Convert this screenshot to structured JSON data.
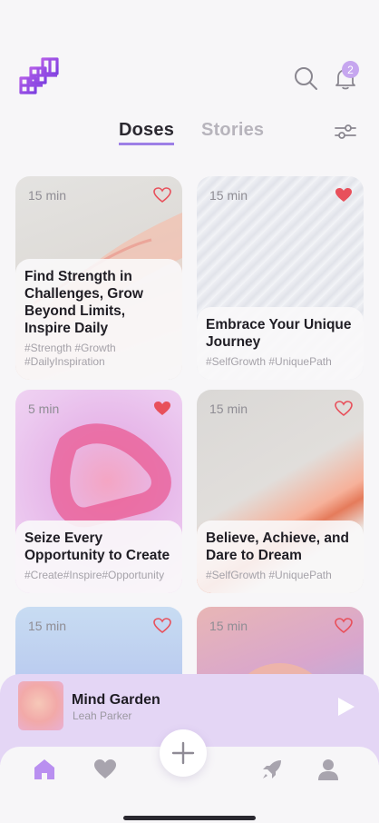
{
  "header": {
    "notification_count": "2"
  },
  "tabs": [
    {
      "label": "Doses",
      "active": true
    },
    {
      "label": "Stories",
      "active": false
    }
  ],
  "cards": [
    {
      "duration": "15 min",
      "liked": false,
      "title": "Find Strength in Challenges, Grow Beyond Limits, Inspire Daily",
      "tags": "#Strength #Growth #DailyInspiration"
    },
    {
      "duration": "15 min",
      "liked": true,
      "title": "Embrace Your Unique Journey",
      "tags": "#SelfGrowth #UniquePath"
    },
    {
      "duration": "5 min",
      "liked": true,
      "title": "Seize Every Opportunity to Create",
      "tags": "#Create#Inspire#Opportunity"
    },
    {
      "duration": "15 min",
      "liked": false,
      "title": "Believe, Achieve, and Dare to Dream",
      "tags": "#SelfGrowth #UniquePath"
    },
    {
      "duration": "15 min",
      "liked": false
    },
    {
      "duration": "15 min",
      "liked": false
    }
  ],
  "player": {
    "title": "Mind Garden",
    "artist": "Leah Parker"
  },
  "colors": {
    "accent": "#9d7fe6",
    "heart": "#e8505b",
    "player_bg": "#e4d6f5"
  },
  "nav": [
    "home-icon",
    "heart-icon",
    "rocket-icon",
    "profile-icon"
  ]
}
